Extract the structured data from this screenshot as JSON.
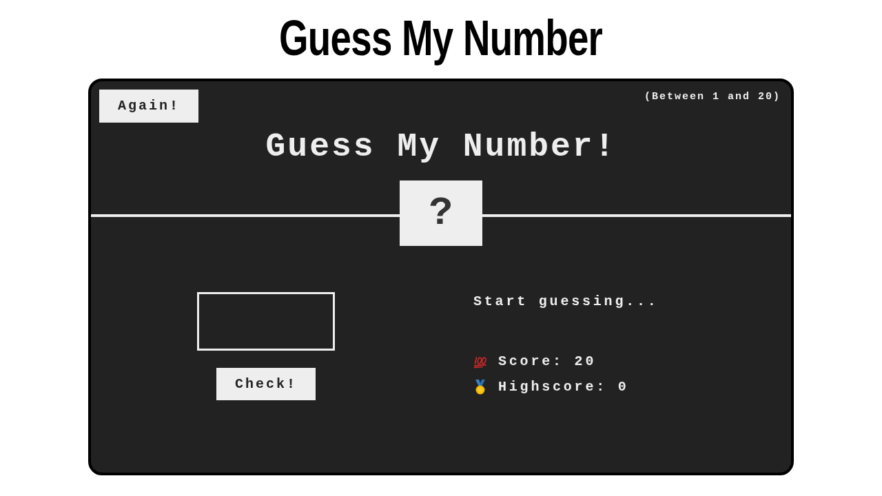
{
  "page_title": "Guess My Number",
  "game": {
    "again_button": "Again!",
    "range_hint": "(Between 1 and 20)",
    "heading": "Guess My Number!",
    "secret_number": "?",
    "check_button": "Check!",
    "message": "Start guessing...",
    "stats": [
      {
        "kind": "score",
        "text": "Score: 20"
      },
      {
        "kind": "highscore",
        "text": "Highscore: 0"
      }
    ]
  }
}
